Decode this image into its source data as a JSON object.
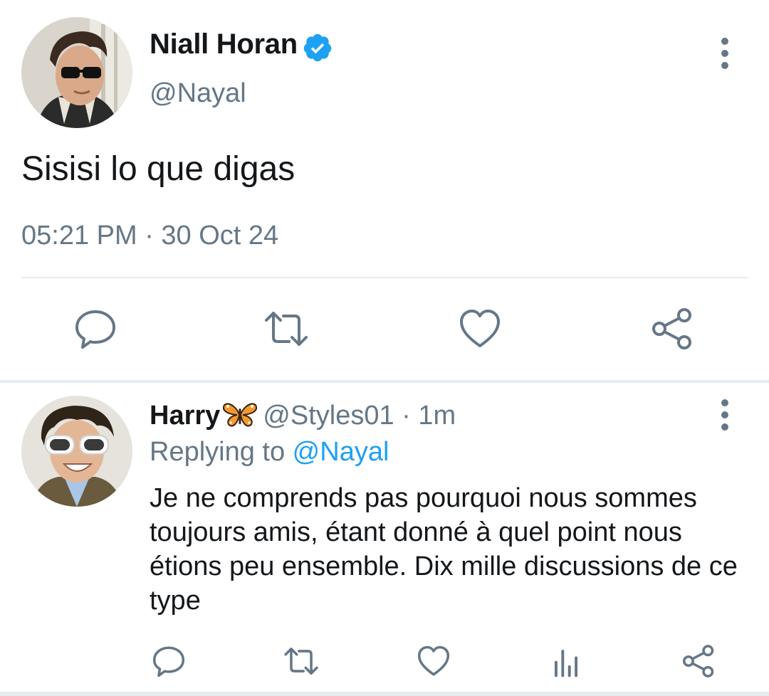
{
  "main_tweet": {
    "author_name": "Niall Horan",
    "verified": true,
    "handle": "@Nayal",
    "text": "Sisisi lo que digas",
    "timestamp": "05:21 PM · 30 Oct 24",
    "actions": [
      "reply-icon",
      "retweet-icon",
      "like-icon",
      "share-icon"
    ]
  },
  "reply_tweet": {
    "author_name": "Harry",
    "name_emoji": "butterfly-icon",
    "handle": "@Styles01",
    "time_meta": " · 1m",
    "replying_label": "Replying to ",
    "replying_to": "@Nayal",
    "text": "Je ne comprends pas pourquoi nous sommes toujours amis, étant donné à quel point nous étions peu ensemble. Dix mille discussions de ce type",
    "actions": [
      "reply-icon",
      "retweet-icon",
      "like-icon",
      "stats-icon",
      "share-icon"
    ]
  },
  "colors": {
    "text_primary": "#14171a",
    "text_secondary": "#657786",
    "accent": "#1da1f2",
    "divider": "#e6ecf0"
  }
}
